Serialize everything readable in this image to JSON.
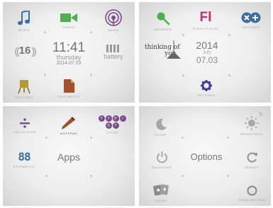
{
  "screens": [
    {
      "tiles": [
        {
          "label": "MUSIC",
          "icon": "music-note-icon"
        },
        {
          "label": "VIDEOS",
          "icon": "video-camera-icon"
        },
        {
          "label": "RADIO",
          "icon": "radio-icon"
        },
        {
          "label": "",
          "icon": "volume-level-icon",
          "value": "16"
        },
        {
          "label": "battery",
          "icon": "battery-icon"
        },
        {
          "label": "PICTURES",
          "icon": "easel-icon"
        },
        {
          "label": "DOCUMENTS",
          "icon": "document-icon"
        }
      ],
      "clock": {
        "time": "11:41",
        "day": "thursday",
        "date": "2014.07.03"
      }
    },
    {
      "tiles": [
        {
          "label": "BROWSER",
          "icon": "magnifier-icon"
        },
        {
          "label": "FLASH PLAYER",
          "icon": "flash-player-icon",
          "glyph": "Fl"
        },
        {
          "label": "DECODER",
          "icon": "decoder-icon"
        },
        {
          "label": "SETTINGS",
          "icon": "gear-icon"
        }
      ],
      "note": {
        "line1": "thinking of",
        "line2": "you"
      },
      "date": {
        "year": "2014",
        "month": "July",
        "day": "07.03"
      }
    },
    {
      "tiles": [
        {
          "label": "CALCULATOR",
          "icon": "divide-icon"
        },
        {
          "label": "NOTEPAD",
          "icon": "pencil-icon"
        },
        {
          "label": "TYPIST",
          "icon": "typist-keys-icon",
          "keys": [
            "T",
            "Y",
            "P",
            "I",
            "S",
            "T"
          ]
        },
        {
          "label": "STOPWATCH",
          "icon": "stopwatch-digits-icon",
          "glyph": "88"
        }
      ],
      "title": "Apps"
    },
    {
      "tiles": [
        {
          "label": "SLEEP",
          "icon": "moon-icon"
        },
        {
          "label": "BRIGHTNESS",
          "icon": "sun-icon",
          "value": "5"
        },
        {
          "label": "SHUTDOWN",
          "icon": "power-icon"
        },
        {
          "label": "REBOOT",
          "icon": "refresh-icon"
        },
        {
          "label": "CARDS",
          "icon": "playing-cards-icon"
        },
        {
          "label": "ZOOM DEFINED",
          "icon": "circle-icon"
        }
      ],
      "title": "Options"
    }
  ],
  "colors": {
    "blue": "#3b6ea5",
    "green": "#4caf50",
    "purple": "#7a4a8c",
    "brown": "#a0522d",
    "gray": "#9a9a9a"
  }
}
